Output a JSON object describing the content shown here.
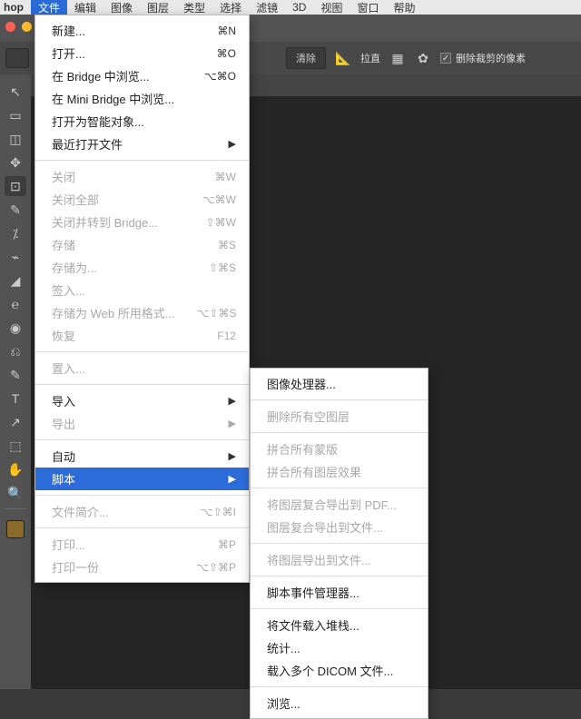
{
  "menubar": {
    "app": "hop",
    "items": [
      "文件",
      "编辑",
      "图像",
      "图层",
      "类型",
      "选择",
      "滤镜",
      "3D",
      "视图",
      "窗口",
      "帮助"
    ],
    "active_index": 0
  },
  "optionsbar": {
    "clear": "清除",
    "straighten": "拉直",
    "delete_cropped": "删除裁剪的像素"
  },
  "file_menu": [
    {
      "t": "item",
      "label": "新建...",
      "accel": "⌘N"
    },
    {
      "t": "item",
      "label": "打开...",
      "accel": "⌘O"
    },
    {
      "t": "item",
      "label": "在 Bridge 中浏览...",
      "accel": "⌥⌘O"
    },
    {
      "t": "item",
      "label": "在 Mini Bridge 中浏览..."
    },
    {
      "t": "item",
      "label": "打开为智能对象..."
    },
    {
      "t": "item",
      "label": "最近打开文件",
      "submenu": true
    },
    {
      "t": "sep"
    },
    {
      "t": "item",
      "label": "关闭",
      "accel": "⌘W",
      "dim": true
    },
    {
      "t": "item",
      "label": "关闭全部",
      "accel": "⌥⌘W",
      "dim": true
    },
    {
      "t": "item",
      "label": "关闭并转到 Bridge...",
      "accel": "⇧⌘W",
      "dim": true
    },
    {
      "t": "item",
      "label": "存储",
      "accel": "⌘S",
      "dim": true
    },
    {
      "t": "item",
      "label": "存储为...",
      "accel": "⇧⌘S",
      "dim": true
    },
    {
      "t": "item",
      "label": "签入...",
      "dim": true
    },
    {
      "t": "item",
      "label": "存储为 Web 所用格式...",
      "accel": "⌥⇧⌘S",
      "dim": true
    },
    {
      "t": "item",
      "label": "恢复",
      "accel": "F12",
      "dim": true
    },
    {
      "t": "sep"
    },
    {
      "t": "item",
      "label": "置入...",
      "dim": true
    },
    {
      "t": "sep"
    },
    {
      "t": "item",
      "label": "导入",
      "submenu": true
    },
    {
      "t": "item",
      "label": "导出",
      "submenu": true,
      "dim": true
    },
    {
      "t": "sep"
    },
    {
      "t": "item",
      "label": "自动",
      "submenu": true
    },
    {
      "t": "item",
      "label": "脚本",
      "submenu": true,
      "hl": true
    },
    {
      "t": "sep"
    },
    {
      "t": "item",
      "label": "文件简介...",
      "accel": "⌥⇧⌘I",
      "dim": true
    },
    {
      "t": "sep"
    },
    {
      "t": "item",
      "label": "打印...",
      "accel": "⌘P",
      "dim": true
    },
    {
      "t": "item",
      "label": "打印一份",
      "accel": "⌥⇧⌘P",
      "dim": true
    }
  ],
  "script_menu": [
    {
      "t": "item",
      "label": "图像处理器..."
    },
    {
      "t": "sep"
    },
    {
      "t": "item",
      "label": "删除所有空图层",
      "dim": true
    },
    {
      "t": "sep"
    },
    {
      "t": "item",
      "label": "拼合所有蒙版",
      "dim": true
    },
    {
      "t": "item",
      "label": "拼合所有图层效果",
      "dim": true
    },
    {
      "t": "sep"
    },
    {
      "t": "item",
      "label": "将图层复合导出到 PDF...",
      "dim": true
    },
    {
      "t": "item",
      "label": "图层复合导出到文件...",
      "dim": true
    },
    {
      "t": "sep"
    },
    {
      "t": "item",
      "label": "将图层导出到文件...",
      "dim": true
    },
    {
      "t": "sep"
    },
    {
      "t": "item",
      "label": "脚本事件管理器..."
    },
    {
      "t": "sep"
    },
    {
      "t": "item",
      "label": "将文件载入堆栈..."
    },
    {
      "t": "item",
      "label": "统计..."
    },
    {
      "t": "item",
      "label": "载入多个 DICOM 文件..."
    },
    {
      "t": "sep"
    },
    {
      "t": "item",
      "label": "浏览..."
    }
  ],
  "tools": [
    "↖",
    "▭",
    "◫",
    "✥",
    "⊡",
    "✎",
    "⁒",
    "⌁",
    "◢",
    "℮",
    "◉",
    "⎌",
    "✎",
    "T",
    "↗",
    "⬚",
    "✋",
    "🔍"
  ]
}
